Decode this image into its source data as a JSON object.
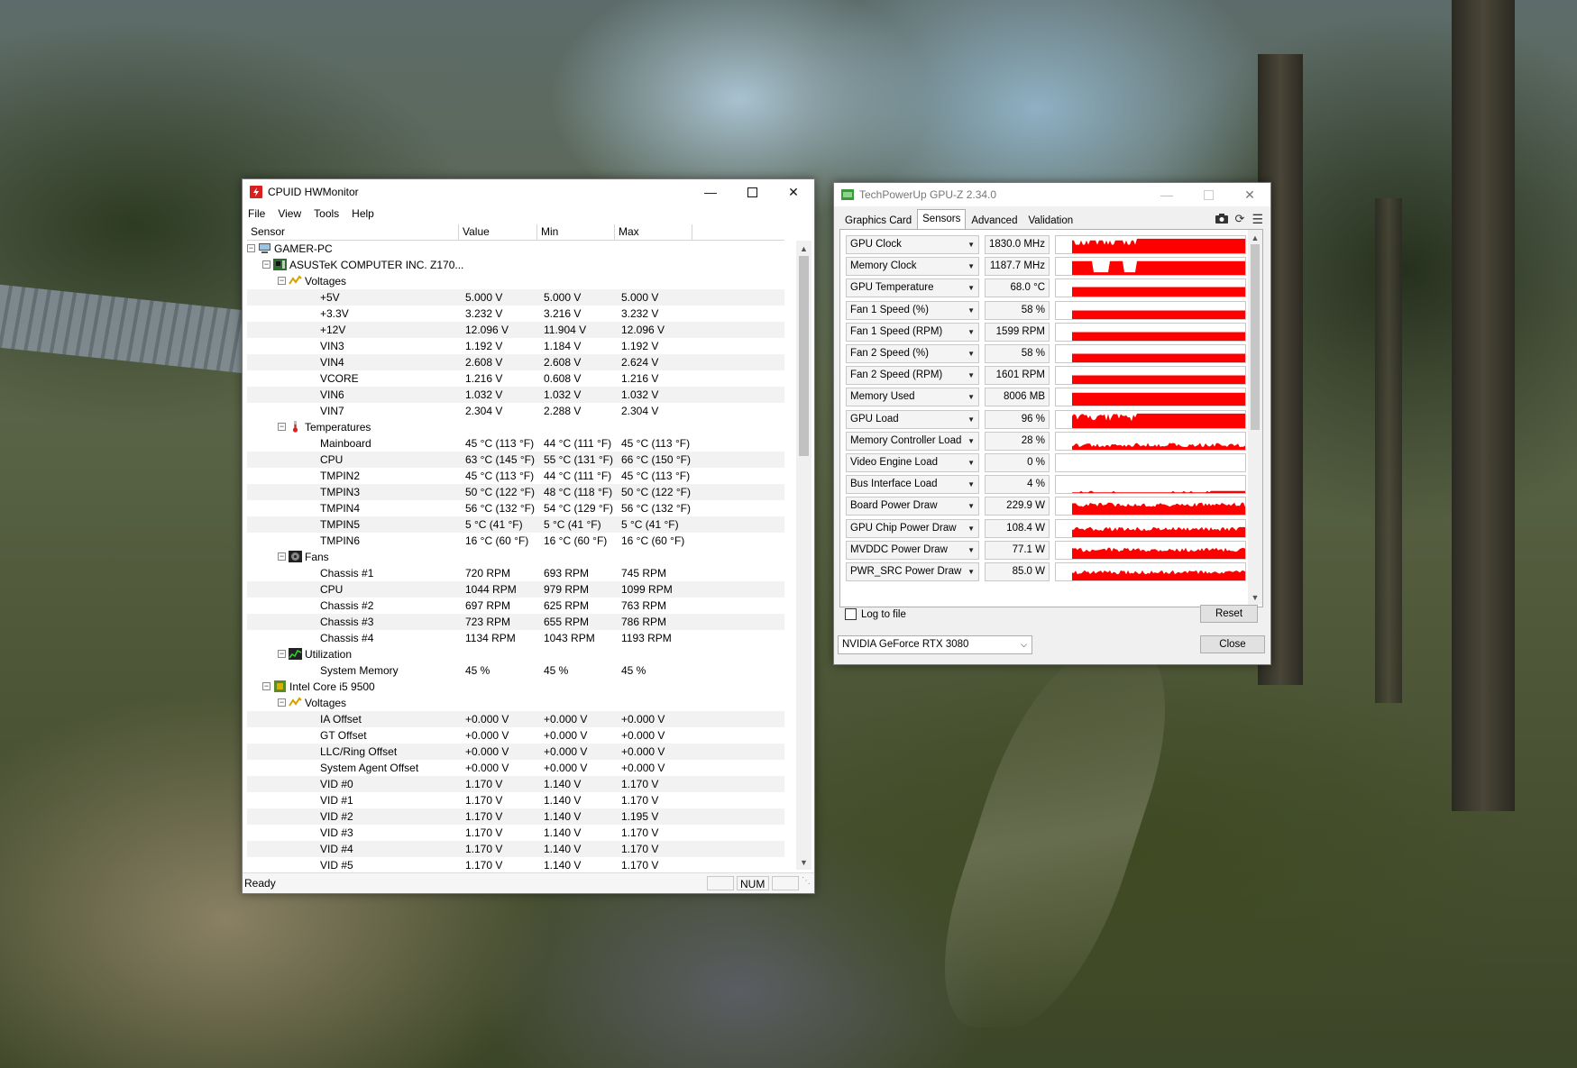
{
  "hwmonitor": {
    "title": "CPUID HWMonitor",
    "menu": [
      "File",
      "View",
      "Tools",
      "Help"
    ],
    "columns": [
      "Sensor",
      "Value",
      "Min",
      "Max"
    ],
    "status": {
      "ready": "Ready",
      "num": "NUM"
    },
    "rows": [
      {
        "depth": 0,
        "type": "node",
        "icon": "computer-icon",
        "label": "GAMER-PC"
      },
      {
        "depth": 1,
        "type": "node",
        "icon": "motherboard-icon",
        "label": "ASUSTeK COMPUTER INC. Z170..."
      },
      {
        "depth": 2,
        "type": "node",
        "icon": "voltage-icon",
        "label": "Voltages"
      },
      {
        "depth": 3,
        "label": "+5V",
        "value": "5.000 V",
        "min": "5.000 V",
        "max": "5.000 V"
      },
      {
        "depth": 3,
        "label": "+3.3V",
        "value": "3.232 V",
        "min": "3.216 V",
        "max": "3.232 V"
      },
      {
        "depth": 3,
        "label": "+12V",
        "value": "12.096 V",
        "min": "11.904 V",
        "max": "12.096 V"
      },
      {
        "depth": 3,
        "label": "VIN3",
        "value": "1.192 V",
        "min": "1.184 V",
        "max": "1.192 V"
      },
      {
        "depth": 3,
        "label": "VIN4",
        "value": "2.608 V",
        "min": "2.608 V",
        "max": "2.624 V"
      },
      {
        "depth": 3,
        "label": "VCORE",
        "value": "1.216 V",
        "min": "0.608 V",
        "max": "1.216 V"
      },
      {
        "depth": 3,
        "label": "VIN6",
        "value": "1.032 V",
        "min": "1.032 V",
        "max": "1.032 V"
      },
      {
        "depth": 3,
        "label": "VIN7",
        "value": "2.304 V",
        "min": "2.288 V",
        "max": "2.304 V"
      },
      {
        "depth": 2,
        "type": "node",
        "icon": "thermometer-icon",
        "label": "Temperatures"
      },
      {
        "depth": 3,
        "label": "Mainboard",
        "value": "45 °C  (113 °F)",
        "min": "44 °C  (111 °F)",
        "max": "45 °C  (113 °F)"
      },
      {
        "depth": 3,
        "label": "CPU",
        "value": "63 °C  (145 °F)",
        "min": "55 °C  (131 °F)",
        "max": "66 °C  (150 °F)"
      },
      {
        "depth": 3,
        "label": "TMPIN2",
        "value": "45 °C  (113 °F)",
        "min": "44 °C  (111 °F)",
        "max": "45 °C  (113 °F)"
      },
      {
        "depth": 3,
        "label": "TMPIN3",
        "value": "50 °C  (122 °F)",
        "min": "48 °C  (118 °F)",
        "max": "50 °C  (122 °F)"
      },
      {
        "depth": 3,
        "label": "TMPIN4",
        "value": "56 °C  (132 °F)",
        "min": "54 °C  (129 °F)",
        "max": "56 °C  (132 °F)"
      },
      {
        "depth": 3,
        "label": "TMPIN5",
        "value": "5 °C  (41 °F)",
        "min": "5 °C  (41 °F)",
        "max": "5 °C  (41 °F)"
      },
      {
        "depth": 3,
        "label": "TMPIN6",
        "value": "16 °C  (60 °F)",
        "min": "16 °C  (60 °F)",
        "max": "16 °C  (60 °F)"
      },
      {
        "depth": 2,
        "type": "node",
        "icon": "fan-icon",
        "label": "Fans"
      },
      {
        "depth": 3,
        "label": "Chassis #1",
        "value": "720 RPM",
        "min": "693 RPM",
        "max": "745 RPM"
      },
      {
        "depth": 3,
        "label": "CPU",
        "value": "1044 RPM",
        "min": "979 RPM",
        "max": "1099 RPM"
      },
      {
        "depth": 3,
        "label": "Chassis #2",
        "value": "697 RPM",
        "min": "625 RPM",
        "max": "763 RPM"
      },
      {
        "depth": 3,
        "label": "Chassis #3",
        "value": "723 RPM",
        "min": "655 RPM",
        "max": "786 RPM"
      },
      {
        "depth": 3,
        "label": "Chassis #4",
        "value": "1134 RPM",
        "min": "1043 RPM",
        "max": "1193 RPM"
      },
      {
        "depth": 2,
        "type": "node",
        "icon": "utilization-icon",
        "label": "Utilization"
      },
      {
        "depth": 3,
        "label": "System Memory",
        "value": "45 %",
        "min": "45 %",
        "max": "45 %"
      },
      {
        "depth": 1,
        "type": "node",
        "icon": "cpu-chip-icon",
        "label": "Intel Core i5 9500"
      },
      {
        "depth": 2,
        "type": "node",
        "icon": "voltage-icon",
        "label": "Voltages"
      },
      {
        "depth": 3,
        "label": "IA Offset",
        "value": "+0.000 V",
        "min": "+0.000 V",
        "max": "+0.000 V"
      },
      {
        "depth": 3,
        "label": "GT Offset",
        "value": "+0.000 V",
        "min": "+0.000 V",
        "max": "+0.000 V"
      },
      {
        "depth": 3,
        "label": "LLC/Ring Offset",
        "value": "+0.000 V",
        "min": "+0.000 V",
        "max": "+0.000 V"
      },
      {
        "depth": 3,
        "label": "System Agent Offset",
        "value": "+0.000 V",
        "min": "+0.000 V",
        "max": "+0.000 V"
      },
      {
        "depth": 3,
        "label": "VID #0",
        "value": "1.170 V",
        "min": "1.140 V",
        "max": "1.170 V"
      },
      {
        "depth": 3,
        "label": "VID #1",
        "value": "1.170 V",
        "min": "1.140 V",
        "max": "1.170 V"
      },
      {
        "depth": 3,
        "label": "VID #2",
        "value": "1.170 V",
        "min": "1.140 V",
        "max": "1.195 V"
      },
      {
        "depth": 3,
        "label": "VID #3",
        "value": "1.170 V",
        "min": "1.140 V",
        "max": "1.170 V"
      },
      {
        "depth": 3,
        "label": "VID #4",
        "value": "1.170 V",
        "min": "1.140 V",
        "max": "1.170 V"
      },
      {
        "depth": 3,
        "label": "VID #5",
        "value": "1.170 V",
        "min": "1.140 V",
        "max": "1.170 V"
      }
    ]
  },
  "gpuz": {
    "title": "TechPowerUp GPU-Z 2.34.0",
    "tabs": [
      "Graphics Card",
      "Sensors",
      "Advanced",
      "Validation"
    ],
    "active_tab": "Sensors",
    "graph_color": "#ff0000",
    "sensors": [
      {
        "name": "GPU Clock",
        "value": "1830.0 MHz",
        "level": 0.85,
        "style": "spiky"
      },
      {
        "name": "Memory Clock",
        "value": "1187.7 MHz",
        "level": 0.8,
        "style": "gap"
      },
      {
        "name": "GPU Temperature",
        "value": "68.0 °C",
        "level": 0.55,
        "style": "flat"
      },
      {
        "name": "Fan 1 Speed (%)",
        "value": "58 %",
        "level": 0.5,
        "style": "flat"
      },
      {
        "name": "Fan 1 Speed (RPM)",
        "value": "1599 RPM",
        "level": 0.5,
        "style": "flat"
      },
      {
        "name": "Fan 2 Speed (%)",
        "value": "58 %",
        "level": 0.5,
        "style": "flat"
      },
      {
        "name": "Fan 2 Speed (RPM)",
        "value": "1601 RPM",
        "level": 0.5,
        "style": "flat"
      },
      {
        "name": "Memory Used",
        "value": "8006 MB",
        "level": 0.75,
        "style": "flat"
      },
      {
        "name": "GPU Load",
        "value": "96 %",
        "level": 0.85,
        "style": "load"
      },
      {
        "name": "Memory Controller Load",
        "value": "28 %",
        "level": 0.4,
        "style": "noisy"
      },
      {
        "name": "Video Engine Load",
        "value": "0 %",
        "level": 0.0,
        "style": "none"
      },
      {
        "name": "Bus Interface Load",
        "value": "4 %",
        "level": 0.12,
        "style": "sparse"
      },
      {
        "name": "Board Power Draw",
        "value": "229.9 W",
        "level": 0.7,
        "style": "noisy"
      },
      {
        "name": "GPU Chip Power Draw",
        "value": "108.4 W",
        "level": 0.6,
        "style": "noisy"
      },
      {
        "name": "MVDDC Power Draw",
        "value": "77.1 W",
        "level": 0.65,
        "style": "noisy"
      },
      {
        "name": "PWR_SRC Power Draw",
        "value": "85.0 W",
        "level": 0.6,
        "style": "noisy"
      }
    ],
    "log_label": "Log to file",
    "reset_label": "Reset",
    "gpu_select": "NVIDIA GeForce RTX 3080",
    "close_label": "Close"
  }
}
